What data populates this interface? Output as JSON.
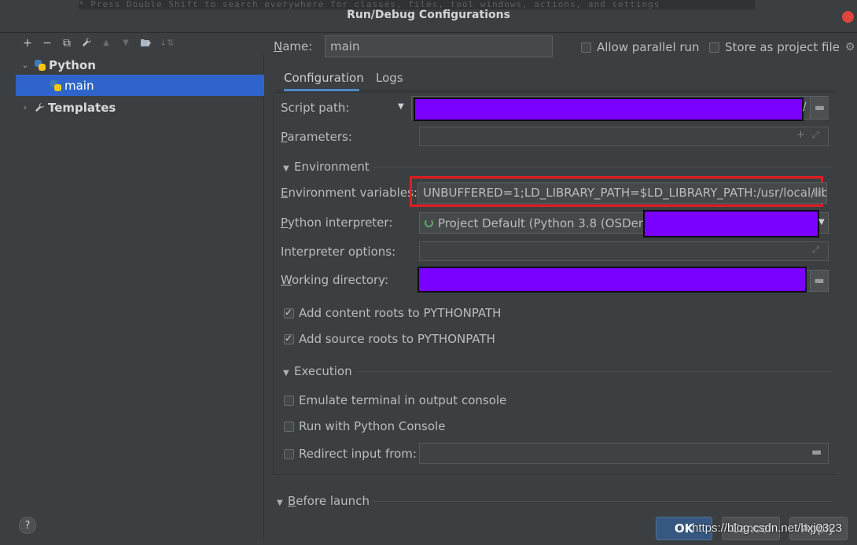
{
  "window": {
    "title": "Run/Debug Configurations",
    "ghost_text": "* Press Double Shift to search everywhere for classes, files, tool windows, actions, and settings"
  },
  "toolbar": {
    "add": "+",
    "remove": "−",
    "copy": "⧉",
    "wrench": "🔧",
    "up": "▲",
    "down": "▼",
    "folder": "▮",
    "sort": "↓⇅"
  },
  "tree": {
    "python_label": "Python",
    "main_label": "main",
    "templates_label": "Templates"
  },
  "header": {
    "name_label": "Name:",
    "name_value": "main",
    "allow_parallel_label": "Allow parallel run",
    "store_label": "Store as project file"
  },
  "tabs": [
    {
      "label": "Configuration",
      "active": true
    },
    {
      "label": "Logs",
      "active": false
    }
  ],
  "config": {
    "script_path_label": "Script path:",
    "parameters_label": "Parameters:",
    "environment_section": "Environment",
    "env_vars_label": "Environment variables:",
    "env_vars_value": "UNBUFFERED=1;LD_LIBRARY_PATH=$LD_LIBRARY_PATH:/usr/local/lib",
    "interpreter_label": "Python interpreter:",
    "interpreter_value": "Project Default (Python 3.8 (OSDemo))",
    "interpreter_options_label": "Interpreter options:",
    "working_dir_label": "Working directory:",
    "add_content_roots_label": "Add content roots to PYTHONPATH",
    "add_source_roots_label": "Add source roots to PYTHONPATH",
    "execution_section": "Execution",
    "emulate_terminal_label": "Emulate terminal in output console",
    "run_console_label": "Run with Python Console",
    "redirect_label": "Redirect input from:"
  },
  "before_launch_label": "Before launch",
  "buttons": {
    "ok": "OK",
    "cancel": "Cancel",
    "apply": "Apply"
  },
  "help_label": "?",
  "watermark": "https://blog.csdn.net/hxj0323",
  "colors": {
    "accent": "#2f65ca",
    "redaction": "#7a00ff",
    "highlight": "#e31b23"
  }
}
